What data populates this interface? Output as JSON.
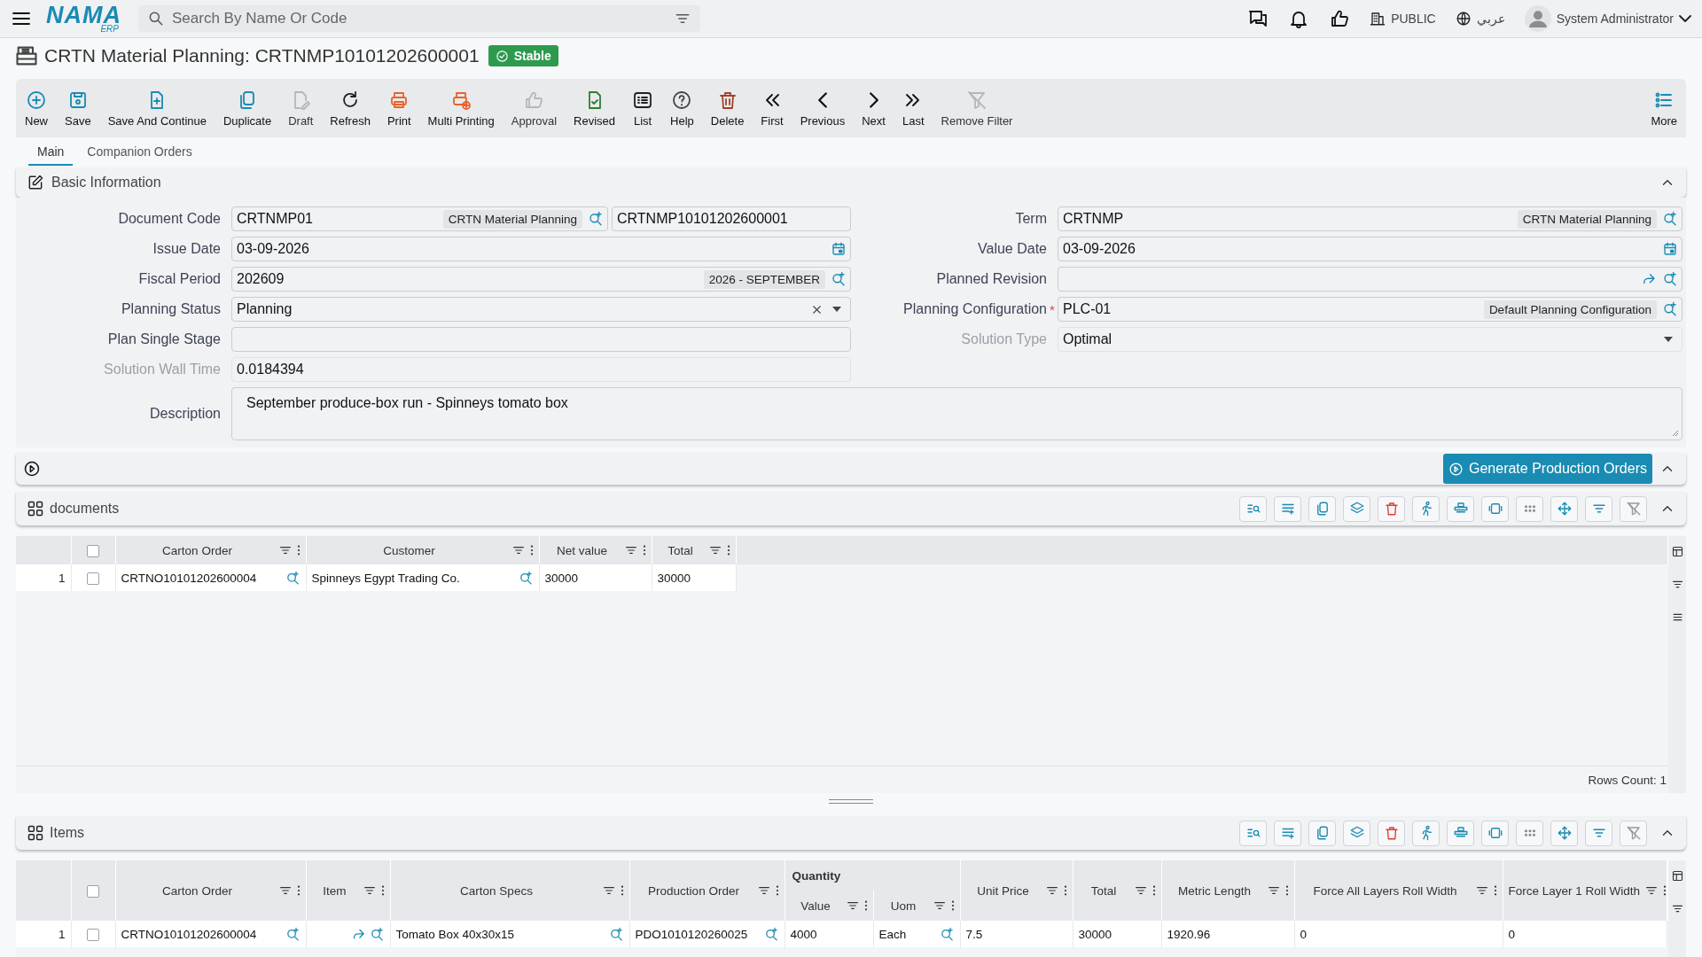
{
  "logo": {
    "text": "NAMA",
    "subtext": "ERP"
  },
  "topbar": {
    "search": {
      "placeholder": "Search By Name Or Code"
    },
    "branch": "PUBLIC",
    "language": "عربي",
    "user": "System Administrator"
  },
  "page": {
    "title": "CRTN Material Planning: CRTNMP10101202600001",
    "status": "Stable"
  },
  "toolbar": [
    {
      "label": "New",
      "kind": "new",
      "disabled": false
    },
    {
      "label": "Save",
      "kind": "save",
      "disabled": false
    },
    {
      "label": "Save And Continue",
      "kind": "save-continue",
      "disabled": false
    },
    {
      "label": "Duplicate",
      "kind": "duplicate",
      "disabled": false
    },
    {
      "label": "Draft",
      "kind": "draft",
      "disabled": true
    },
    {
      "label": "Refresh",
      "kind": "refresh",
      "disabled": false
    },
    {
      "label": "Print",
      "kind": "print",
      "disabled": false
    },
    {
      "label": "Multi Printing",
      "kind": "multi-print",
      "disabled": false
    },
    {
      "label": "Approval",
      "kind": "approval",
      "disabled": true
    },
    {
      "label": "Revised",
      "kind": "revised",
      "disabled": false
    },
    {
      "label": "List",
      "kind": "list",
      "disabled": false
    },
    {
      "label": "Help",
      "kind": "help",
      "disabled": false
    },
    {
      "label": "Delete",
      "kind": "delete",
      "disabled": false
    },
    {
      "label": "First",
      "kind": "first",
      "disabled": false
    },
    {
      "label": "Previous",
      "kind": "previous",
      "disabled": false
    },
    {
      "label": "Next",
      "kind": "next",
      "disabled": false
    },
    {
      "label": "Last",
      "kind": "last",
      "disabled": false
    },
    {
      "label": "Remove Filter",
      "kind": "remove-filter",
      "disabled": true
    }
  ],
  "toolbar_more": {
    "label": "More"
  },
  "tabs": [
    {
      "label": "Main",
      "selected": true
    },
    {
      "label": "Companion Orders",
      "selected": false
    }
  ],
  "basic_information": {
    "title": "Basic Information",
    "expanded": true,
    "left_fields": [
      {
        "label": "Document Code",
        "kind": "lookup",
        "value": "CRTNMP01",
        "tag": "CRTN Material Planning",
        "value_2": "CRTNMP10101202600001",
        "disabled": false,
        "required": false
      },
      {
        "label": "Issue Date",
        "kind": "date",
        "value": "03-09-2026",
        "disabled": false,
        "required": false
      },
      {
        "label": "Fiscal Period",
        "kind": "lookup",
        "value": "202609",
        "tag": "2026 - SEPTEMBER",
        "disabled": false,
        "required": false
      },
      {
        "label": "Planning Status",
        "kind": "select-clear",
        "value": "Planning",
        "disabled": false,
        "required": false
      },
      {
        "label": "Plan Single Stage",
        "kind": "text",
        "disabled": false,
        "required": false
      },
      {
        "label": "Solution Wall Time",
        "kind": "text",
        "value": "0.0184394",
        "disabled": true,
        "required": false
      }
    ],
    "right_fields": [
      {
        "label": "Term",
        "kind": "lookup",
        "value": "CRTNMP",
        "tag": "CRTN Material Planning",
        "disabled": false,
        "required": false
      },
      {
        "label": "Value Date",
        "kind": "date",
        "value": "03-09-2026",
        "disabled": false,
        "required": false
      },
      {
        "label": "Planned Revision",
        "kind": "link-lookup",
        "disabled": false,
        "required": false
      },
      {
        "label": "Planning Configuration",
        "kind": "lookup",
        "value": "PLC-01",
        "tag": "Default Planning Configuration",
        "disabled": false,
        "required": true
      },
      {
        "label": "Solution Type",
        "kind": "select",
        "value": "Optimal",
        "disabled": true,
        "required": false
      }
    ],
    "required_mark": "*",
    "description": {
      "label": "Description",
      "value": "September produce-box run - Spinneys tomato box"
    }
  },
  "actions": {
    "generate_button": "Generate Production Orders",
    "expanded": true
  },
  "documents": {
    "title": "documents",
    "expanded": true,
    "select_all": false,
    "columns": [
      {
        "label": "Carton Order",
        "kind": "lookup"
      },
      {
        "label": "Customer",
        "kind": "lookup"
      },
      {
        "label": "Net value",
        "kind": "text"
      },
      {
        "label": "Total",
        "kind": "text"
      }
    ],
    "rows": [
      {
        "number": "1",
        "checked": false,
        "cells": [
          "CRTNO10101202600004",
          "Spinneys Egypt Trading Co.",
          "30000",
          "30000"
        ]
      }
    ],
    "footer": "Rows Count: 1"
  },
  "items": {
    "title": "Items",
    "expanded": true,
    "select_all": false,
    "column_group": {
      "label": "Quantity"
    },
    "columns": [
      {
        "label": "Carton Order",
        "kind": "lookup",
        "in_group": false
      },
      {
        "label": "Item",
        "kind": "link-lookup",
        "in_group": false
      },
      {
        "label": "Carton Specs",
        "kind": "lookup",
        "in_group": false
      },
      {
        "label": "Production Order",
        "kind": "lookup",
        "in_group": false
      },
      {
        "label": "Value",
        "kind": "text",
        "in_group": true
      },
      {
        "label": "Uom",
        "kind": "lookup",
        "in_group": true
      },
      {
        "label": "Unit Price",
        "kind": "text",
        "in_group": false
      },
      {
        "label": "Total",
        "kind": "text",
        "in_group": false
      },
      {
        "label": "Metric Length",
        "kind": "text",
        "in_group": false
      },
      {
        "label": "Force All Layers Roll Width",
        "kind": "text",
        "in_group": false
      },
      {
        "label": "Force Layer 1 Roll Width",
        "kind": "text",
        "in_group": false
      }
    ],
    "rows": [
      {
        "number": "1",
        "checked": false,
        "cells": [
          "CRTNO10101202600004",
          null,
          "Tomato Box 40x30x15",
          "PDO1010120260025",
          "4000",
          "Each",
          "7.5",
          "30000",
          "1920.96",
          "0",
          "0"
        ]
      }
    ]
  }
}
